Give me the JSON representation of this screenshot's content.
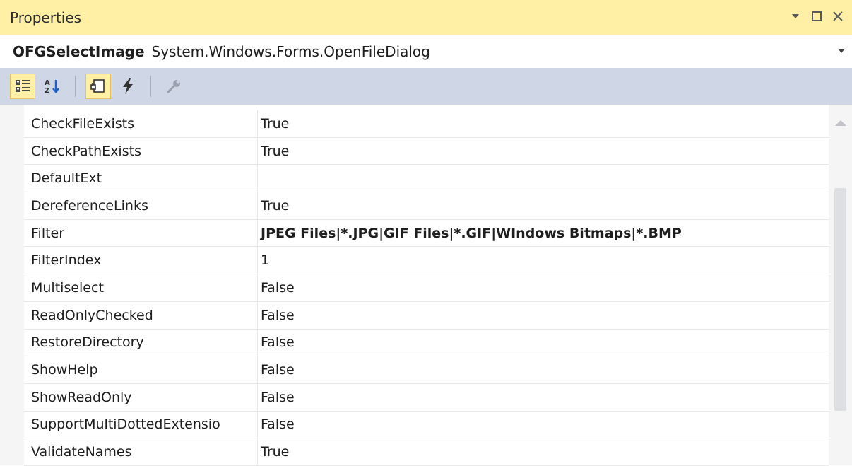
{
  "window": {
    "title": "Properties",
    "controls": {
      "dropdown_icon": "dropdown-arrow-icon",
      "maximize_icon": "maximize-icon",
      "close_icon": "close-icon"
    }
  },
  "object_selector": {
    "name": "OFGSelectImage",
    "type": "System.Windows.Forms.OpenFileDialog"
  },
  "toolbar": {
    "buttons": [
      {
        "icon": "categorized-icon",
        "active": true
      },
      {
        "icon": "alphabetical-sort-icon",
        "active": false
      },
      {
        "icon": "properties-icon",
        "active": true
      },
      {
        "icon": "events-lightning-icon",
        "active": false
      },
      {
        "icon": "property-pages-wrench-icon",
        "active": false
      }
    ]
  },
  "properties": [
    {
      "name": "CheckFileExists",
      "value": "True"
    },
    {
      "name": "CheckPathExists",
      "value": "True"
    },
    {
      "name": "DefaultExt",
      "value": ""
    },
    {
      "name": "DereferenceLinks",
      "value": "True"
    },
    {
      "name": "Filter",
      "value": "JPEG Files|*.JPG|GIF Files|*.GIF|WIndows Bitmaps|*.BMP",
      "bold": true
    },
    {
      "name": "FilterIndex",
      "value": "1"
    },
    {
      "name": "Multiselect",
      "value": "False"
    },
    {
      "name": "ReadOnlyChecked",
      "value": "False"
    },
    {
      "name": "RestoreDirectory",
      "value": "False"
    },
    {
      "name": "ShowHelp",
      "value": "False"
    },
    {
      "name": "ShowReadOnly",
      "value": "False"
    },
    {
      "name": "SupportMultiDottedExtensio",
      "value": "False"
    },
    {
      "name": "ValidateNames",
      "value": "True"
    }
  ],
  "colors": {
    "titlebar_bg": "#fff0a5",
    "toolbar_bg": "#cfd6e5",
    "active_button_bg": "#fff0a5"
  }
}
